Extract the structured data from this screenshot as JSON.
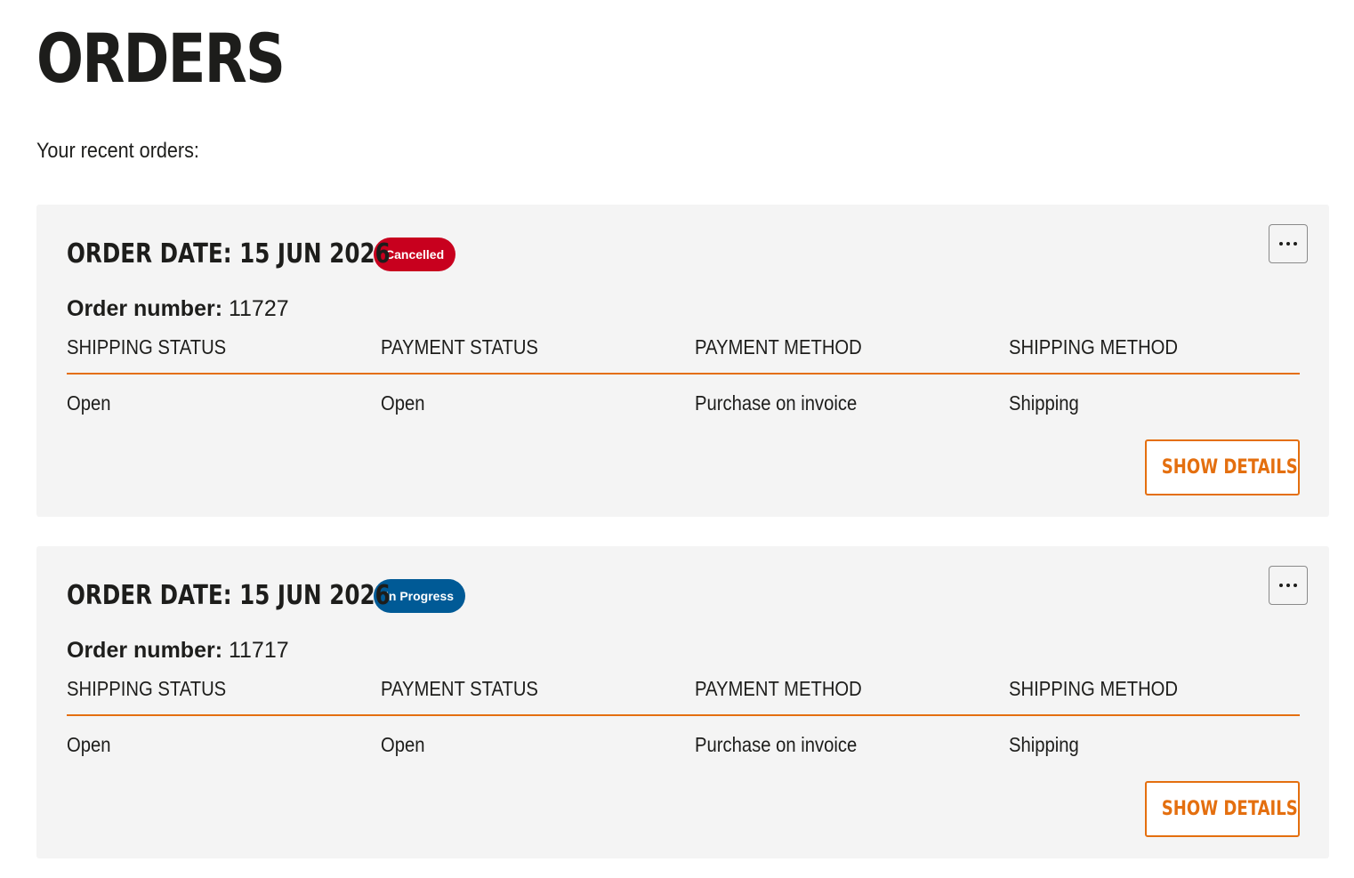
{
  "page": {
    "title": "ORDERS",
    "intro": "Your recent orders:"
  },
  "orders": [
    {
      "date_label": "ORDER DATE:",
      "date": "15 JUN 2026",
      "status": "Cancelled",
      "status_color": "#c8001e",
      "order_number_label": "Order number:",
      "order_number": "11727",
      "columns": [
        "SHIPPING STATUS",
        "PAYMENT STATUS",
        "PAYMENT METHOD",
        "SHIPPING METHOD"
      ],
      "values": [
        "Open",
        "Open",
        "Purchase on invoice",
        "Shipping"
      ],
      "more_icon": "more-horizontal-icon",
      "button_label": "SHOW DETAILS"
    },
    {
      "date_label": "ORDER DATE:",
      "date": "15 JUN 2026",
      "status": "In Progress",
      "status_color": "#005a96",
      "order_number_label": "Order number:",
      "order_number": "11717",
      "columns": [
        "SHIPPING STATUS",
        "PAYMENT STATUS",
        "PAYMENT METHOD",
        "SHIPPING METHOD"
      ],
      "values": [
        "Open",
        "Open",
        "Purchase on invoice",
        "Shipping"
      ],
      "more_icon": "more-horizontal-icon",
      "button_label": "SHOW DETAILS"
    }
  ],
  "colors": {
    "accent": "#e46f0f",
    "card_background": "#f4f4f4",
    "text": "#1d1d1b"
  }
}
